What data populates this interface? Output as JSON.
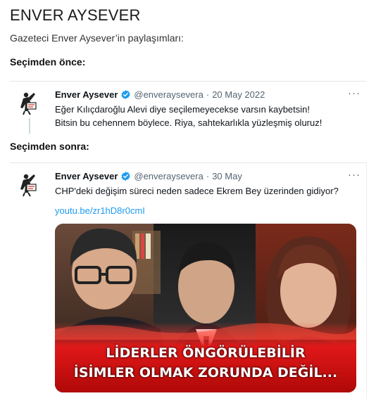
{
  "page": {
    "title": "ENVER AYSEVER",
    "subtitle": "Gazeteci Enver Aysever’in paylaşımları:"
  },
  "sections": {
    "before": "Seçimden önce:",
    "after": "Seçimden sonra:"
  },
  "tweet1": {
    "author": "Enver Aysever",
    "handle": "@enveraysevera",
    "date": "20 May 2022",
    "line1": "Eğer Kılıçdaroğlu Alevi diye seçilemeyecekse varsın kaybetsin!",
    "line2": "Bitsin bu cehennem böylece. Riya, sahtekarlıkla yüzleşmiş oluruz!"
  },
  "tweet2": {
    "author": "Enver Aysever",
    "handle": "@enveraysevera",
    "date": "30 May",
    "text": "CHP'deki değişim süreci neden sadece Ekrem Bey üzerinden gidiyor?",
    "link": "youtu.be/zr1hD8r0cmI",
    "caption_line1": "LİDERLER ÖNGÖRÜLEBİLİR",
    "caption_line2": "İSİMLER OLMAK ZORUNDA DEĞİL..."
  },
  "ui": {
    "separator": "·",
    "more": "···"
  },
  "colors": {
    "link": "#1d9bf0",
    "verified": "#1d9bf0",
    "secondary_text": "#536471",
    "caption_background": "#e02020"
  },
  "icons": [
    "avatar-logo",
    "verified-badge-icon",
    "more-options-icon"
  ]
}
